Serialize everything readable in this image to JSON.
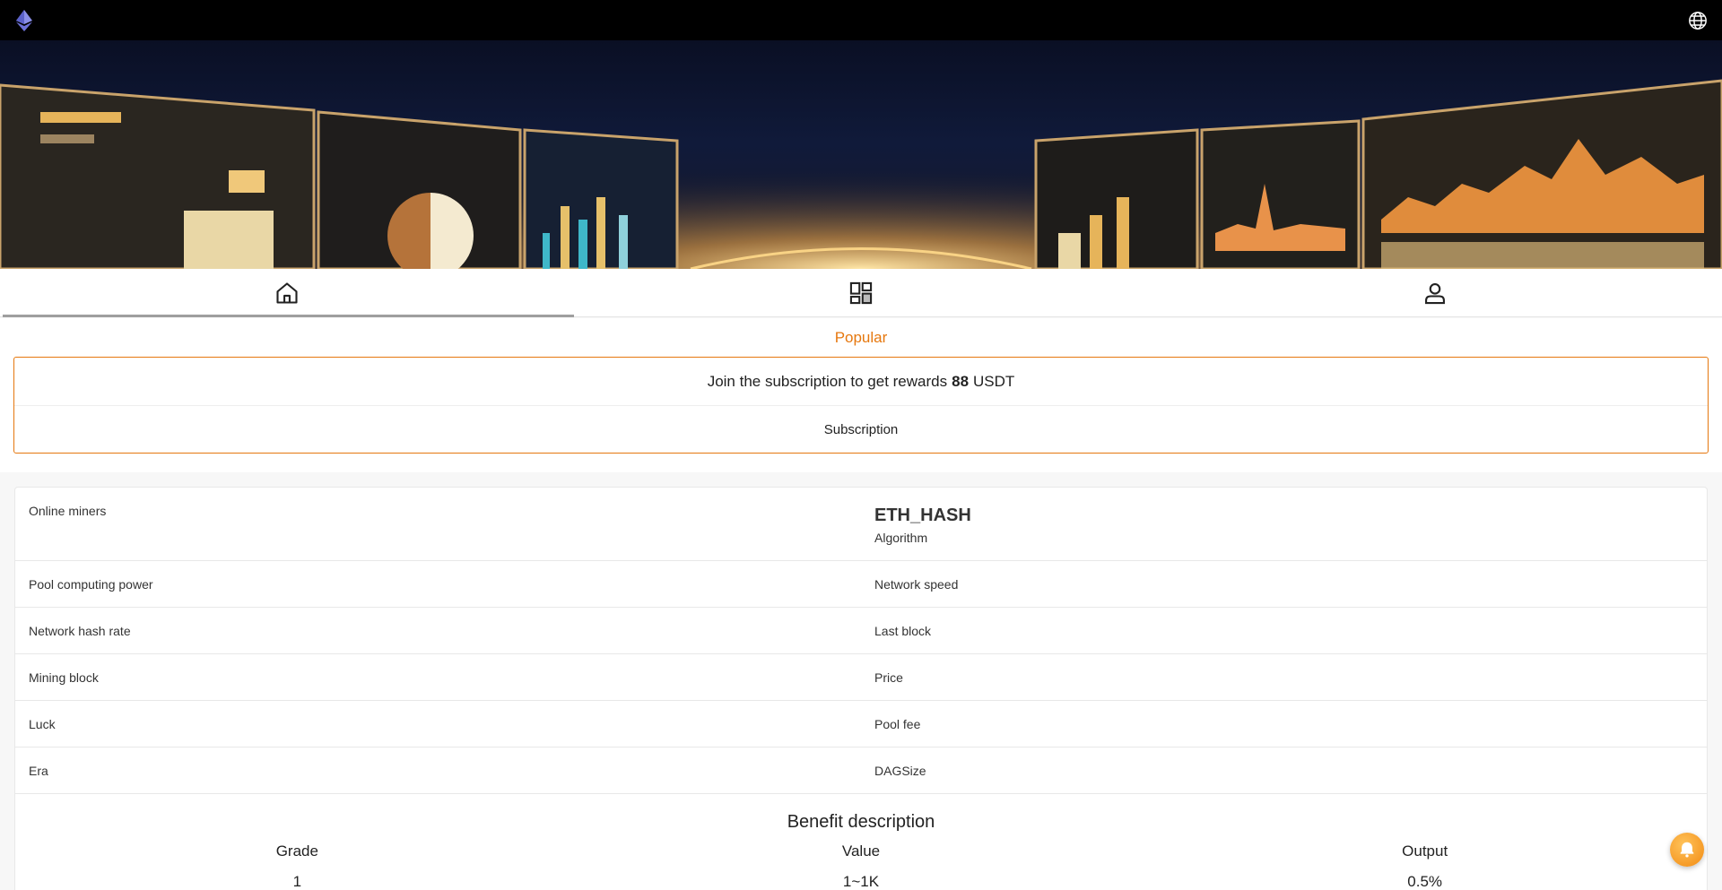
{
  "header": {
    "logo_icon": "ethereum-diamond-icon",
    "language_icon": "globe-icon"
  },
  "banner": {
    "image": "mining-dashboard-banner"
  },
  "nav": {
    "tabs": [
      {
        "icon": "home-icon",
        "active": true
      },
      {
        "icon": "grid-icon",
        "active": false
      },
      {
        "icon": "user-icon",
        "active": false
      }
    ]
  },
  "popular": {
    "title": "Popular",
    "promo_prefix": "Join the subscription to get rewards",
    "promo_amount": "88",
    "promo_suffix": "USDT",
    "subscribe_label": "Subscription"
  },
  "stats": {
    "online_miners_label": "Online miners",
    "algorithm_value": "ETH_HASH",
    "algorithm_label": "Algorithm",
    "rows": [
      {
        "left": "Pool computing power",
        "right": "Network speed"
      },
      {
        "left": "Network hash rate",
        "right": "Last block"
      },
      {
        "left": "Mining block",
        "right": "Price"
      },
      {
        "left": "Luck",
        "right": "Pool fee"
      },
      {
        "left": "Era",
        "right": "DAGSize"
      }
    ]
  },
  "benefit": {
    "title": "Benefit description",
    "headers": [
      "Grade",
      "Value",
      "Output"
    ],
    "rows": [
      [
        "1",
        "1~1K",
        "0.5%"
      ]
    ]
  },
  "fab": {
    "icon": "customer-service-icon"
  },
  "colors": {
    "accent": "#e6780f",
    "topbar": "#000000"
  }
}
